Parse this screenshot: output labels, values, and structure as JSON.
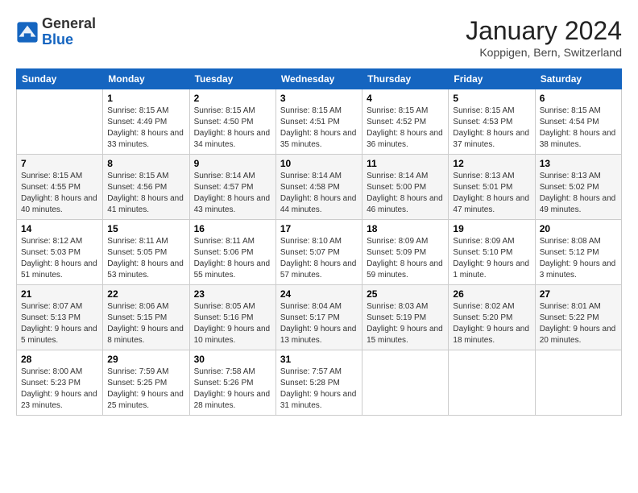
{
  "logo": {
    "general": "General",
    "blue": "Blue"
  },
  "header": {
    "month": "January 2024",
    "location": "Koppigen, Bern, Switzerland"
  },
  "weekdays": [
    "Sunday",
    "Monday",
    "Tuesday",
    "Wednesday",
    "Thursday",
    "Friday",
    "Saturday"
  ],
  "weeks": [
    [
      {
        "day": null
      },
      {
        "day": "1",
        "sunrise": "8:15 AM",
        "sunset": "4:49 PM",
        "daylight": "8 hours and 33 minutes."
      },
      {
        "day": "2",
        "sunrise": "8:15 AM",
        "sunset": "4:50 PM",
        "daylight": "8 hours and 34 minutes."
      },
      {
        "day": "3",
        "sunrise": "8:15 AM",
        "sunset": "4:51 PM",
        "daylight": "8 hours and 35 minutes."
      },
      {
        "day": "4",
        "sunrise": "8:15 AM",
        "sunset": "4:52 PM",
        "daylight": "8 hours and 36 minutes."
      },
      {
        "day": "5",
        "sunrise": "8:15 AM",
        "sunset": "4:53 PM",
        "daylight": "8 hours and 37 minutes."
      },
      {
        "day": "6",
        "sunrise": "8:15 AM",
        "sunset": "4:54 PM",
        "daylight": "8 hours and 38 minutes."
      }
    ],
    [
      {
        "day": "7",
        "sunrise": "8:15 AM",
        "sunset": "4:55 PM",
        "daylight": "8 hours and 40 minutes."
      },
      {
        "day": "8",
        "sunrise": "8:15 AM",
        "sunset": "4:56 PM",
        "daylight": "8 hours and 41 minutes."
      },
      {
        "day": "9",
        "sunrise": "8:14 AM",
        "sunset": "4:57 PM",
        "daylight": "8 hours and 43 minutes."
      },
      {
        "day": "10",
        "sunrise": "8:14 AM",
        "sunset": "4:58 PM",
        "daylight": "8 hours and 44 minutes."
      },
      {
        "day": "11",
        "sunrise": "8:14 AM",
        "sunset": "5:00 PM",
        "daylight": "8 hours and 46 minutes."
      },
      {
        "day": "12",
        "sunrise": "8:13 AM",
        "sunset": "5:01 PM",
        "daylight": "8 hours and 47 minutes."
      },
      {
        "day": "13",
        "sunrise": "8:13 AM",
        "sunset": "5:02 PM",
        "daylight": "8 hours and 49 minutes."
      }
    ],
    [
      {
        "day": "14",
        "sunrise": "8:12 AM",
        "sunset": "5:03 PM",
        "daylight": "8 hours and 51 minutes."
      },
      {
        "day": "15",
        "sunrise": "8:11 AM",
        "sunset": "5:05 PM",
        "daylight": "8 hours and 53 minutes."
      },
      {
        "day": "16",
        "sunrise": "8:11 AM",
        "sunset": "5:06 PM",
        "daylight": "8 hours and 55 minutes."
      },
      {
        "day": "17",
        "sunrise": "8:10 AM",
        "sunset": "5:07 PM",
        "daylight": "8 hours and 57 minutes."
      },
      {
        "day": "18",
        "sunrise": "8:09 AM",
        "sunset": "5:09 PM",
        "daylight": "8 hours and 59 minutes."
      },
      {
        "day": "19",
        "sunrise": "8:09 AM",
        "sunset": "5:10 PM",
        "daylight": "9 hours and 1 minute."
      },
      {
        "day": "20",
        "sunrise": "8:08 AM",
        "sunset": "5:12 PM",
        "daylight": "9 hours and 3 minutes."
      }
    ],
    [
      {
        "day": "21",
        "sunrise": "8:07 AM",
        "sunset": "5:13 PM",
        "daylight": "9 hours and 5 minutes."
      },
      {
        "day": "22",
        "sunrise": "8:06 AM",
        "sunset": "5:15 PM",
        "daylight": "9 hours and 8 minutes."
      },
      {
        "day": "23",
        "sunrise": "8:05 AM",
        "sunset": "5:16 PM",
        "daylight": "9 hours and 10 minutes."
      },
      {
        "day": "24",
        "sunrise": "8:04 AM",
        "sunset": "5:17 PM",
        "daylight": "9 hours and 13 minutes."
      },
      {
        "day": "25",
        "sunrise": "8:03 AM",
        "sunset": "5:19 PM",
        "daylight": "9 hours and 15 minutes."
      },
      {
        "day": "26",
        "sunrise": "8:02 AM",
        "sunset": "5:20 PM",
        "daylight": "9 hours and 18 minutes."
      },
      {
        "day": "27",
        "sunrise": "8:01 AM",
        "sunset": "5:22 PM",
        "daylight": "9 hours and 20 minutes."
      }
    ],
    [
      {
        "day": "28",
        "sunrise": "8:00 AM",
        "sunset": "5:23 PM",
        "daylight": "9 hours and 23 minutes."
      },
      {
        "day": "29",
        "sunrise": "7:59 AM",
        "sunset": "5:25 PM",
        "daylight": "9 hours and 25 minutes."
      },
      {
        "day": "30",
        "sunrise": "7:58 AM",
        "sunset": "5:26 PM",
        "daylight": "9 hours and 28 minutes."
      },
      {
        "day": "31",
        "sunrise": "7:57 AM",
        "sunset": "5:28 PM",
        "daylight": "9 hours and 31 minutes."
      },
      {
        "day": null
      },
      {
        "day": null
      },
      {
        "day": null
      }
    ]
  ],
  "labels": {
    "sunrise": "Sunrise:",
    "sunset": "Sunset:",
    "daylight": "Daylight:"
  }
}
